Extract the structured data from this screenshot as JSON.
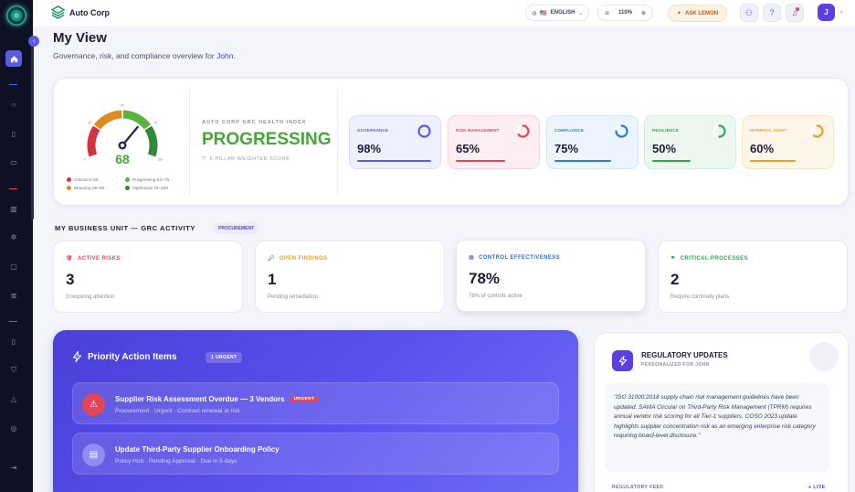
{
  "topbar": {
    "brand": "Auto Corp",
    "language": "ENGLISH",
    "language_flag": "🇺🇸",
    "zoom": "110%",
    "ask_label": "ASK LEMON",
    "avatar_initial": "J"
  },
  "header": {
    "title": "My View",
    "subtitle_prefix": "Governance, risk, and compliance overview for ",
    "user_name": "John",
    "subtitle_suffix": "."
  },
  "health": {
    "score": "68",
    "tick_labels": [
      "0",
      "25",
      "50",
      "75",
      "100"
    ],
    "score_value": 68,
    "legend": [
      "Critical 0–25",
      "Progressing 51–75",
      "Maturing 26–50",
      "Optimized 76–100"
    ],
    "index_label": "AUTO CORP GRC HEALTH INDEX",
    "status": "PROGRESSING",
    "note": "5-PILLAR WEIGHTED SCORE",
    "colors": {
      "critical": "#d1343f",
      "maturing": "#e08a1e",
      "progressing": "#58b33f",
      "optimized": "#2f8a3a"
    }
  },
  "pillars": [
    {
      "name": "GOVERNANCE",
      "value": "98%",
      "pct": 98,
      "color": "#5b5ce6",
      "bg": "#eef0fd",
      "border": "#d9ddfa"
    },
    {
      "name": "RISK MANAGEMENT",
      "value": "65%",
      "pct": 65,
      "color": "#e2455a",
      "bg": "#fdeef1",
      "border": "#f8d6dc"
    },
    {
      "name": "COMPLIANCE",
      "value": "75%",
      "pct": 75,
      "color": "#2b7fd6",
      "bg": "#ecf4fd",
      "border": "#d3e5f8"
    },
    {
      "name": "RESILIENCE",
      "value": "50%",
      "pct": 50,
      "color": "#2ea84a",
      "bg": "#ecf8ef",
      "border": "#d3eedb"
    },
    {
      "name": "INTERNAL AUDIT",
      "value": "60%",
      "pct": 60,
      "color": "#e6a21a",
      "bg": "#fdf6e8",
      "border": "#f6e6c4"
    }
  ],
  "business_unit": {
    "title": "MY BUSINESS UNIT — GRC ACTIVITY",
    "badge": "PROCUREMENT",
    "kpis": [
      {
        "label": "ACTIVE RISKS",
        "value": "3",
        "note": "3 requiring attention",
        "color": "#e2455a",
        "icon": "🛡"
      },
      {
        "label": "OPEN FINDINGS",
        "value": "1",
        "note": "Pending remediation",
        "color": "#e6a21a",
        "icon": "🔎"
      },
      {
        "label": "CONTROL EFFECTIVENESS",
        "value": "78%",
        "note": "78% of controls active",
        "color": "#2b6fd6",
        "icon": "▦"
      },
      {
        "label": "CRITICAL PROCESSES",
        "value": "2",
        "note": "Require continuity plans",
        "color": "#2ea84a",
        "icon": "⚑"
      }
    ]
  },
  "priority": {
    "title": "Priority Action Items",
    "badge": "1 URGENT",
    "items": [
      {
        "title": "Supplier Risk Assessment Overdue — 3 Vendors",
        "chip": "URGENT",
        "sub": "Procurement · Urgent · Contract renewal at risk",
        "icon": "⚠",
        "icon_bg": "#e2455a"
      },
      {
        "title": "Update Third-Party Supplier Onboarding Policy",
        "chip": "",
        "sub": "Policy Hub · Pending Approval · Due in 5 days",
        "icon": "▤",
        "icon_bg": "#8e8cf5"
      }
    ]
  },
  "regulatory": {
    "title": "REGULATORY UPDATES",
    "subtitle": "PERSONALIZED FOR JOHN",
    "quote": "\"ISO 31000:2018 supply chain risk management guidelines have been updated. SAMA Circular on Third-Party Risk Management (TPRM) requires annual vendor risk scoring for all Tier-1 suppliers. COSO 2023 update highlights supplier concentration risk as an emerging enterprise risk category requiring board-level disclosure.\"",
    "feed_label": "REGULATORY FEED",
    "live_label": "● LIVE"
  }
}
